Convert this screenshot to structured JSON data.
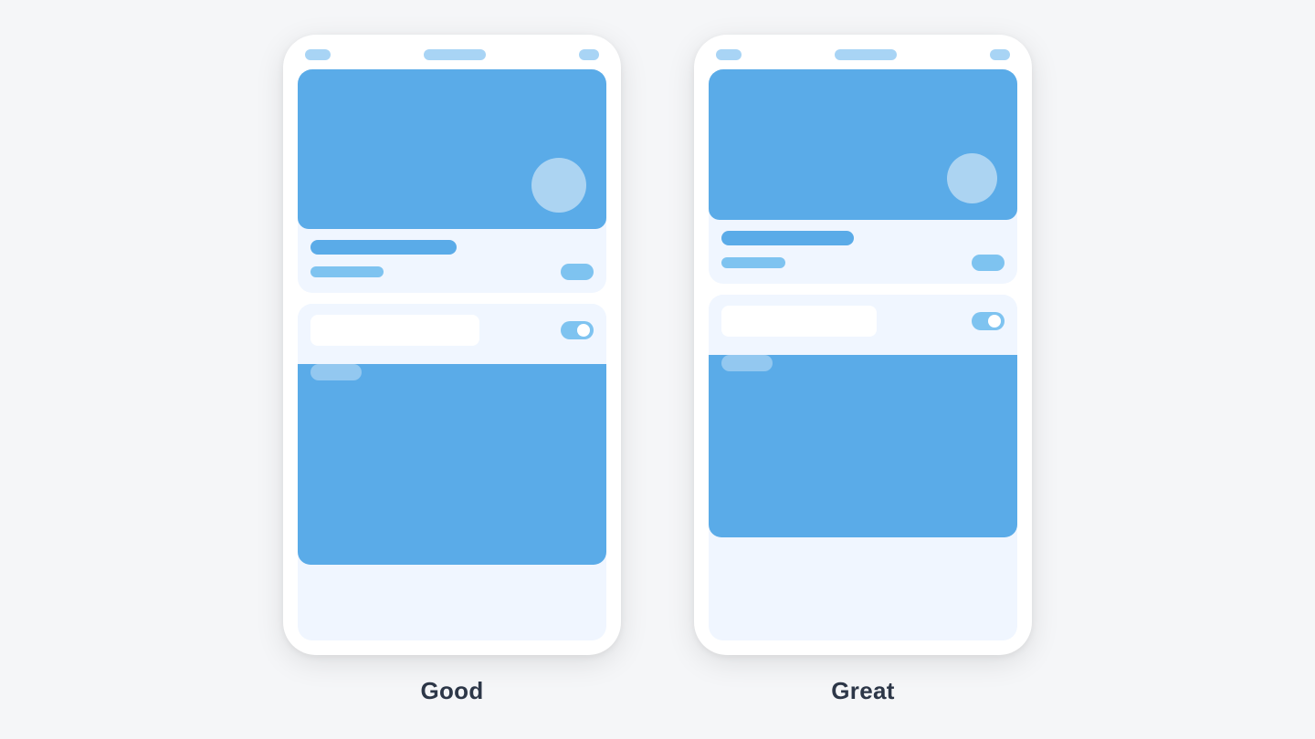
{
  "phones": [
    {
      "id": "good",
      "label": "Good",
      "accent": "#5aabe8",
      "light_accent": "#a8d4f5"
    },
    {
      "id": "great",
      "label": "Great",
      "accent": "#5aabe8",
      "light_accent": "#a8d4f5"
    }
  ],
  "labels": {
    "good": "Good",
    "great": "Great"
  }
}
